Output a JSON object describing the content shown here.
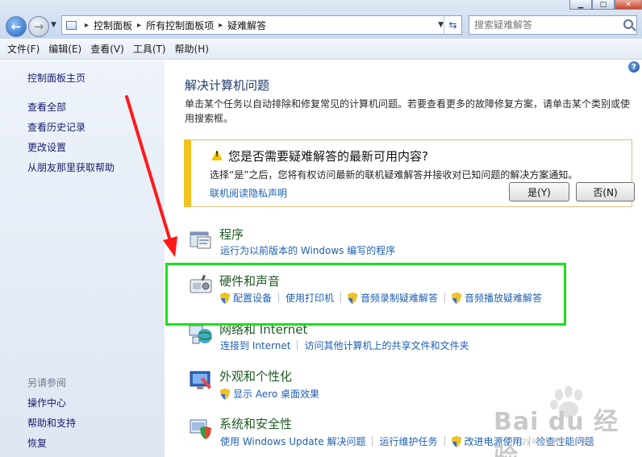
{
  "address_bar": {
    "crumbs": [
      "控制面板",
      "所有控制面板项",
      "疑难解答"
    ]
  },
  "search": {
    "placeholder": "搜索疑难解答"
  },
  "menu": [
    "文件(F)",
    "编辑(E)",
    "查看(V)",
    "工具(T)",
    "帮助(H)"
  ],
  "sidebar": {
    "links": [
      "控制面板主页",
      "查看全部",
      "查看历史记录",
      "更改设置",
      "从朋友那里获取帮助"
    ],
    "see_also_heading": "另请参阅",
    "see_also": [
      "操作中心",
      "帮助和支持",
      "恢复"
    ]
  },
  "main": {
    "title": "解决计算机问题",
    "description": "单击某个任务以自动排除和修复常见的计算机问题。若要查看更多的故障修复方案，请单击某个类别或使用搜索框。"
  },
  "notice": {
    "title": "您是否需要疑难解答的最新可用内容?",
    "text": "选择“是”之后，您将有权访问最新的联机疑难解答并接收对已知问题的解决方案通知。",
    "link": "联机阅读隐私声明",
    "yes": "是(Y)",
    "no": "否(N)"
  },
  "categories": [
    {
      "title": "程序",
      "icon": "programs-icon",
      "links": [
        {
          "label": "运行为以前版本的 Windows 编写的程序",
          "shield": false
        }
      ]
    },
    {
      "title": "硬件和声音",
      "icon": "hardware-sound-icon",
      "links": [
        {
          "label": "配置设备",
          "shield": true
        },
        {
          "label": "使用打印机",
          "shield": false
        },
        {
          "label": "音频录制疑难解答",
          "shield": true
        },
        {
          "label": "音频播放疑难解答",
          "shield": true
        }
      ]
    },
    {
      "title": "网络和 Internet",
      "icon": "network-icon",
      "links": [
        {
          "label": "连接到 Internet",
          "shield": false
        },
        {
          "label": "访问其他计算机上的共享文件和文件夹",
          "shield": false
        }
      ]
    },
    {
      "title": "外观和个性化",
      "icon": "appearance-icon",
      "links": [
        {
          "label": "显示 Aero 桌面效果",
          "shield": true
        }
      ]
    },
    {
      "title": "系统和安全性",
      "icon": "system-security-icon",
      "links": [
        {
          "label": "使用 Windows Update 解决问题",
          "shield": false
        },
        {
          "label": "运行维护任务",
          "shield": false
        },
        {
          "label": "改进电源使用",
          "shield": true
        },
        {
          "label": "检查性能问题",
          "shield": false
        }
      ]
    }
  ],
  "watermark": {
    "text": "Bai du 经验",
    "sub": "jingyan.baidu.com"
  },
  "colors": {
    "link": "#1d5fb3",
    "category_title": "#1f5a22",
    "highlight_box": "#19e01a",
    "arrow": "#ff1a1a"
  }
}
